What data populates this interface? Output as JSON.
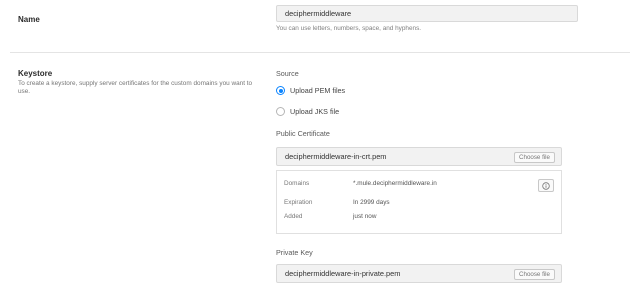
{
  "name_section": {
    "label": "Name",
    "value": "deciphermiddleware",
    "hint": "You can use letters, numbers, space, and hyphens."
  },
  "keystore_section": {
    "label": "Keystore",
    "description": "To create a keystore, supply server certificates for the custom domains you want to use.",
    "source_label": "Source",
    "source_options": [
      {
        "label": "Upload PEM files",
        "selected": true
      },
      {
        "label": "Upload JKS file",
        "selected": false
      }
    ],
    "public_certificate": {
      "label": "Public Certificate",
      "file_name": "deciphermiddleware-in-crt.pem",
      "choose_label": "Choose file",
      "details": {
        "domains_key": "Domains",
        "domains_value": "*.mule.deciphermiddleware.in",
        "expiration_key": "Expiration",
        "expiration_value": "In 2999 days",
        "added_key": "Added",
        "added_value": "just now"
      },
      "info_icon": "info-circle-icon"
    },
    "private_key": {
      "label": "Private Key",
      "file_name": "deciphermiddleware-in-private.pem",
      "choose_label": "Choose file"
    }
  },
  "colors": {
    "accent": "#0a84ff",
    "input_bg": "#f2f2f2",
    "divider": "#e4e4e4"
  }
}
